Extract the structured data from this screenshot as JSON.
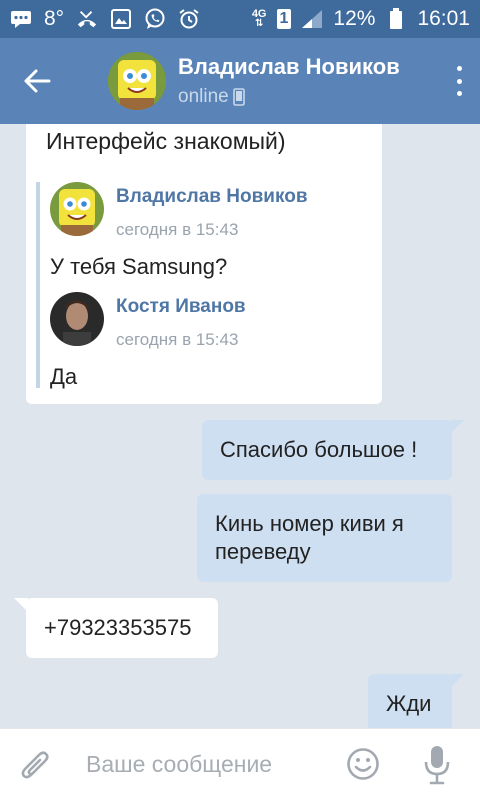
{
  "status_bar": {
    "temperature": "8°",
    "network": "4G",
    "sim_slot": "1",
    "battery": "12%",
    "time": "16:01"
  },
  "header": {
    "contact_name": "Владислав Новиков",
    "contact_status": "online"
  },
  "messages": {
    "forwarded": {
      "top_text": "Интерфейс знакомый)",
      "items": [
        {
          "author": "Владислав Новиков",
          "time": "сегодня в 15:43",
          "text": "У тебя Samsung?"
        },
        {
          "author": "Костя Иванов",
          "time": "сегодня в 15:43",
          "text": "Да"
        }
      ]
    },
    "out1": "Спасибо большое !",
    "out2_line1": "Кинь номер киви я",
    "out2_line2": "переведу",
    "in1": "+79323353575",
    "out3": "Жди"
  },
  "composer": {
    "placeholder": "Ваше сообщение"
  },
  "colors": {
    "status_bar": "#3e6a9c",
    "app_bar": "#5a84b8",
    "chat_bg": "#dfe5ec",
    "outgoing_bubble": "#cfdff2",
    "incoming_bubble": "#ffffff",
    "author_name": "#4f77a6"
  },
  "icons": [
    "chat-icon",
    "weather-icon",
    "missed-call-icon",
    "gallery-icon",
    "whatsapp-icon",
    "alarm-icon",
    "signal-icon",
    "battery-icon",
    "back-arrow-icon",
    "overflow-menu-icon",
    "phone-icon",
    "attach-icon",
    "emoji-icon",
    "mic-icon"
  ]
}
